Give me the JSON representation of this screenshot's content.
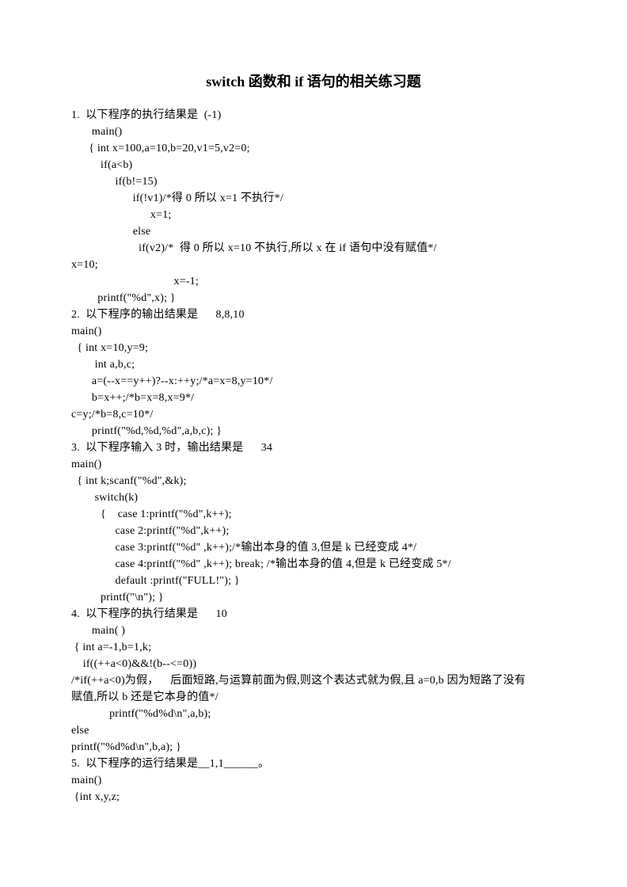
{
  "title": "switch 函数和 if 语句的相关练习题",
  "lines": [
    "1.  以下程序的执行结果是  (-1)",
    "       main()",
    "      { int x=100,a=10,b=20,v1=5,v2=0;",
    "          if(a<b)",
    "               if(b!=15)",
    "                     if(!v1)/*得 0 所以 x=1 不执行*/",
    "                           x=1;",
    "                     else",
    "                       if(v2)/*  得 0 所以 x=10 不执行,所以 x 在 if 语句中没有赋值*/",
    "x=10;",
    "                                   x=-1;",
    "         printf(\"%d\",x); }",
    "2.  以下程序的输出结果是      8,8,10",
    "main()",
    "  { int x=10,y=9;",
    "        int a,b,c;",
    "       a=(--x==y++)?--x:++y;/*a=x=8,y=10*/",
    "       b=x++;/*b=x=8,x=9*/",
    "c=y;/*b=8,c=10*/",
    "       printf(\"%d,%d,%d\",a,b,c); }",
    "3.  以下程序输入 3 时，输出结果是      34",
    "main()",
    "  { int k;scanf(\"%d\",&k);",
    "        switch(k)",
    "          {    case 1:printf(\"%d\",k++);",
    "               case 2:printf(\"%d\",k++);",
    "               case 3:printf(\"%d\" ,k++);/*输出本身的值 3,但是 k 已经变成 4*/",
    "               case 4:printf(\"%d\" ,k++); break; /*输出本身的值 4,但是 k 已经变成 5*/",
    "               default :printf(\"FULL!\"); }",
    "          printf(\"\\n\"); }",
    "4.  以下程序的执行结果是      10",
    "       main( )",
    " { int a=-1,b=1,k;",
    "    if((++a<0)&&!(b--<=0))",
    "/*if(++a<0)为假，    后面短路,与运算前面为假,则这个表达式就为假,且 a=0,b 因为短路了没有",
    "赋值,所以 b 还是它本身的值*/",
    "             printf(\"%d%d\\n\",a,b);",
    "else",
    "printf(\"%d%d\\n\",b,a); }",
    "5.  以下程序的运行结果是__1,1______。",
    "main()",
    " {int x,y,z;"
  ]
}
